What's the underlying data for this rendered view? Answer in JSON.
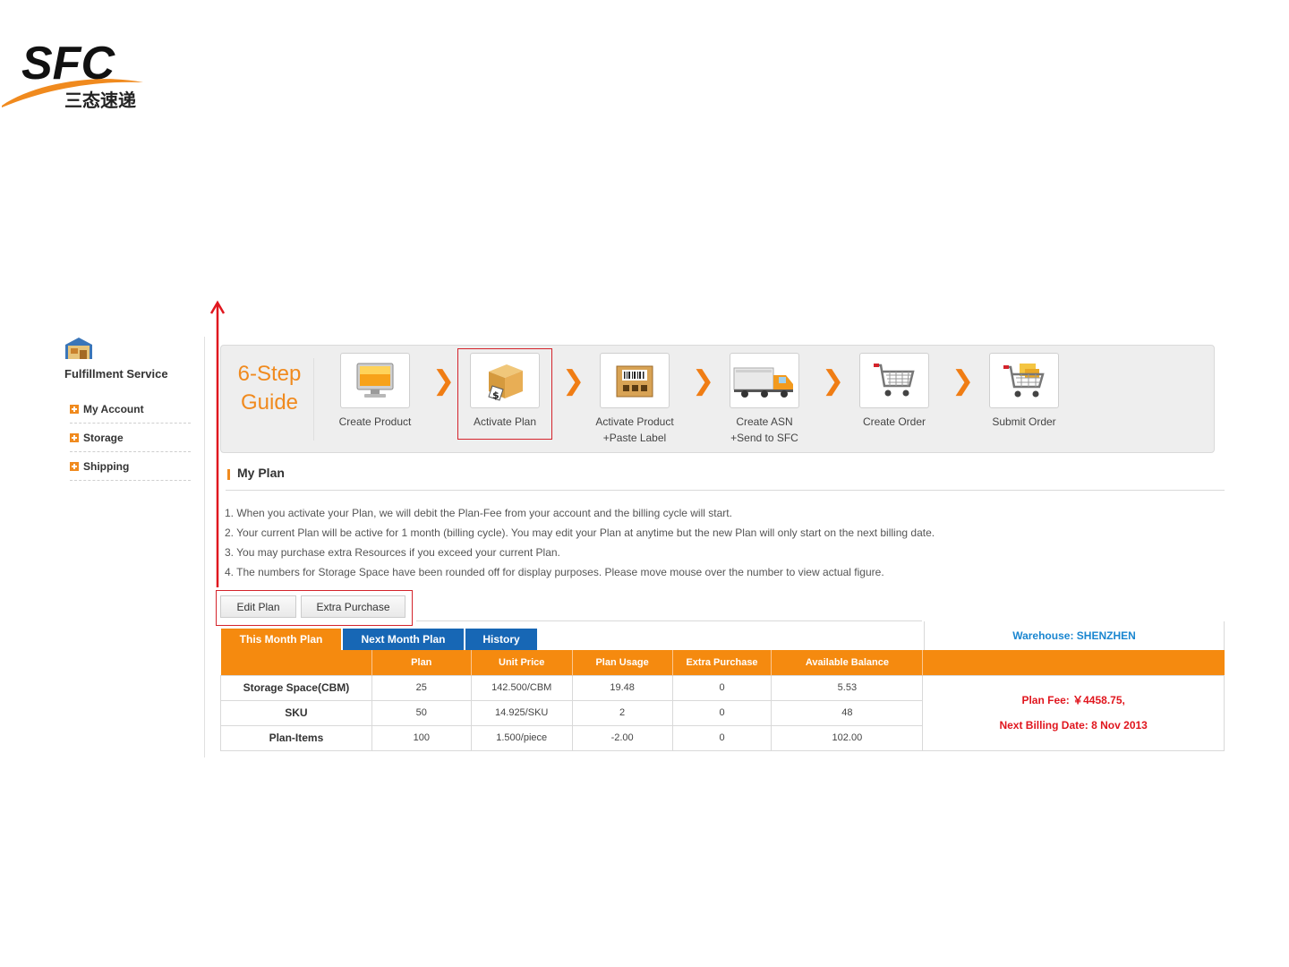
{
  "logo": {
    "text": "SFC",
    "subtitle": "三态速递"
  },
  "sidebar": {
    "icon": "warehouse-icon",
    "title": "Fulfillment Service",
    "items": [
      {
        "label": "My Account"
      },
      {
        "label": "Storage"
      },
      {
        "label": "Shipping"
      }
    ]
  },
  "guide": {
    "title_line1": "6-Step",
    "title_line2": "Guide",
    "steps": [
      {
        "line1": "Create Product",
        "line2": "",
        "icon": "monitor-icon"
      },
      {
        "line1": "Activate Plan",
        "line2": "",
        "icon": "box-price-tag-icon",
        "selected": true
      },
      {
        "line1": "Activate Product",
        "line2": "+Paste Label",
        "icon": "barcode-box-icon"
      },
      {
        "line1": "Create ASN",
        "line2": "+Send to SFC",
        "icon": "truck-icon"
      },
      {
        "line1": "Create Order",
        "line2": "",
        "icon": "shopping-cart-icon"
      },
      {
        "line1": "Submit Order",
        "line2": "",
        "icon": "loaded-cart-icon"
      }
    ]
  },
  "my_plan": {
    "title": "My Plan",
    "notes": [
      "1. When you activate your Plan, we will debit the Plan-Fee from your account and the billing cycle will start.",
      "2. Your current Plan will be active for 1 month (billing cycle). You may edit your Plan at anytime but the new Plan will only start on the next billing date.",
      "3. You may purchase extra Resources if you exceed your current Plan.",
      "4. The numbers for Storage Space have been rounded off for display purposes. Please move mouse over the number to view actual figure."
    ],
    "buttons": {
      "edit": "Edit Plan",
      "extra": "Extra Purchase"
    },
    "tabs": [
      "This Month Plan",
      "Next Month Plan",
      "History"
    ],
    "warehouse": "Warehouse: SHENZHEN",
    "table": {
      "headers": [
        "",
        "Plan",
        "Unit Price",
        "Plan Usage",
        "Extra Purchase",
        "Available Balance",
        ""
      ],
      "rows": [
        [
          "Storage Space(CBM)",
          "25",
          "142.500/CBM",
          "19.48",
          "0",
          "5.53"
        ],
        [
          "SKU",
          "50",
          "14.925/SKU",
          "2",
          "0",
          "48"
        ],
        [
          "Plan-Items",
          "100",
          "1.500/piece",
          "-2.00",
          "0",
          "102.00"
        ]
      ]
    },
    "plan_fee": "Plan Fee: ￥4458.75,",
    "next_billing": "Next Billing Date: 8 Nov 2013"
  },
  "colors": {
    "brand_orange": "#f58a0f",
    "tab_blue": "#1767b5",
    "highlight_red": "#d4232b",
    "warehouse_blue": "#1a86d0"
  }
}
